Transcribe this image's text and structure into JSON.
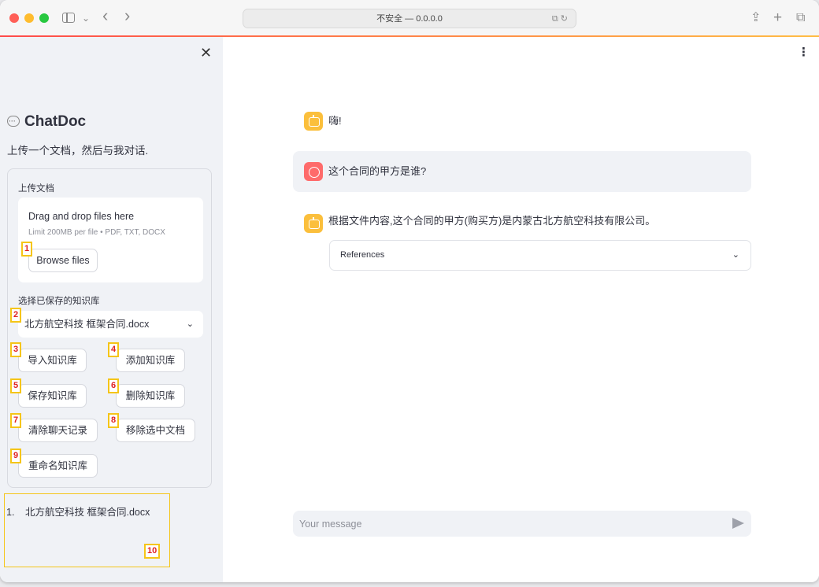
{
  "browser": {
    "url_text": "不安全 — 0.0.0.0",
    "url_icons": "⧉ ↻",
    "back_glyph": "‹",
    "forward_glyph": "›",
    "dropdown_glyph": "⌄",
    "share_glyph": "⇪",
    "newtab_glyph": "+",
    "tabs_glyph": "⧉"
  },
  "sidebar": {
    "close_glyph": "✕",
    "title": "ChatDoc",
    "subtitle": "上传一个文档，然后与我对话.",
    "upload": {
      "label": "上传文档",
      "drop_title": "Drag and drop files here",
      "limit": "Limit 200MB per file • PDF, TXT, DOCX",
      "browse_label": "Browse files"
    },
    "kb_select": {
      "label": "选择已保存的知识库",
      "value": "北方航空科技 框架合同.docx",
      "chevron": "⌄"
    },
    "buttons": {
      "import": "导入知识库",
      "add": "添加知识库",
      "save": "保存知识库",
      "delete": "删除知识库",
      "clear": "清除聊天记录",
      "remove": "移除选中文档",
      "rename": "重命名知识库"
    },
    "doc_list": [
      {
        "num": "1.",
        "name": "北方航空科技 框架合同.docx"
      }
    ]
  },
  "markers": [
    "1",
    "2",
    "3",
    "4",
    "5",
    "6",
    "7",
    "8",
    "9",
    "10"
  ],
  "main": {
    "menu_glyph": "⋮",
    "messages": [
      {
        "role": "assistant",
        "text": "嗨!"
      },
      {
        "role": "user",
        "text": "这个合同的甲方是谁?"
      },
      {
        "role": "assistant",
        "text": "根据文件内容,这个合同的甲方(购买方)是内蒙古北方航空科技有限公司。"
      }
    ],
    "references_label": "References",
    "references_chevron": "⌄",
    "chat_input_placeholder": "Your message"
  },
  "colors": {
    "bot_avatar": "#fbbf3c",
    "user_avatar": "#fe6b6b",
    "marker_border": "#f5c518",
    "marker_text": "#e02020",
    "sidebar_bg": "#f0f2f6"
  }
}
